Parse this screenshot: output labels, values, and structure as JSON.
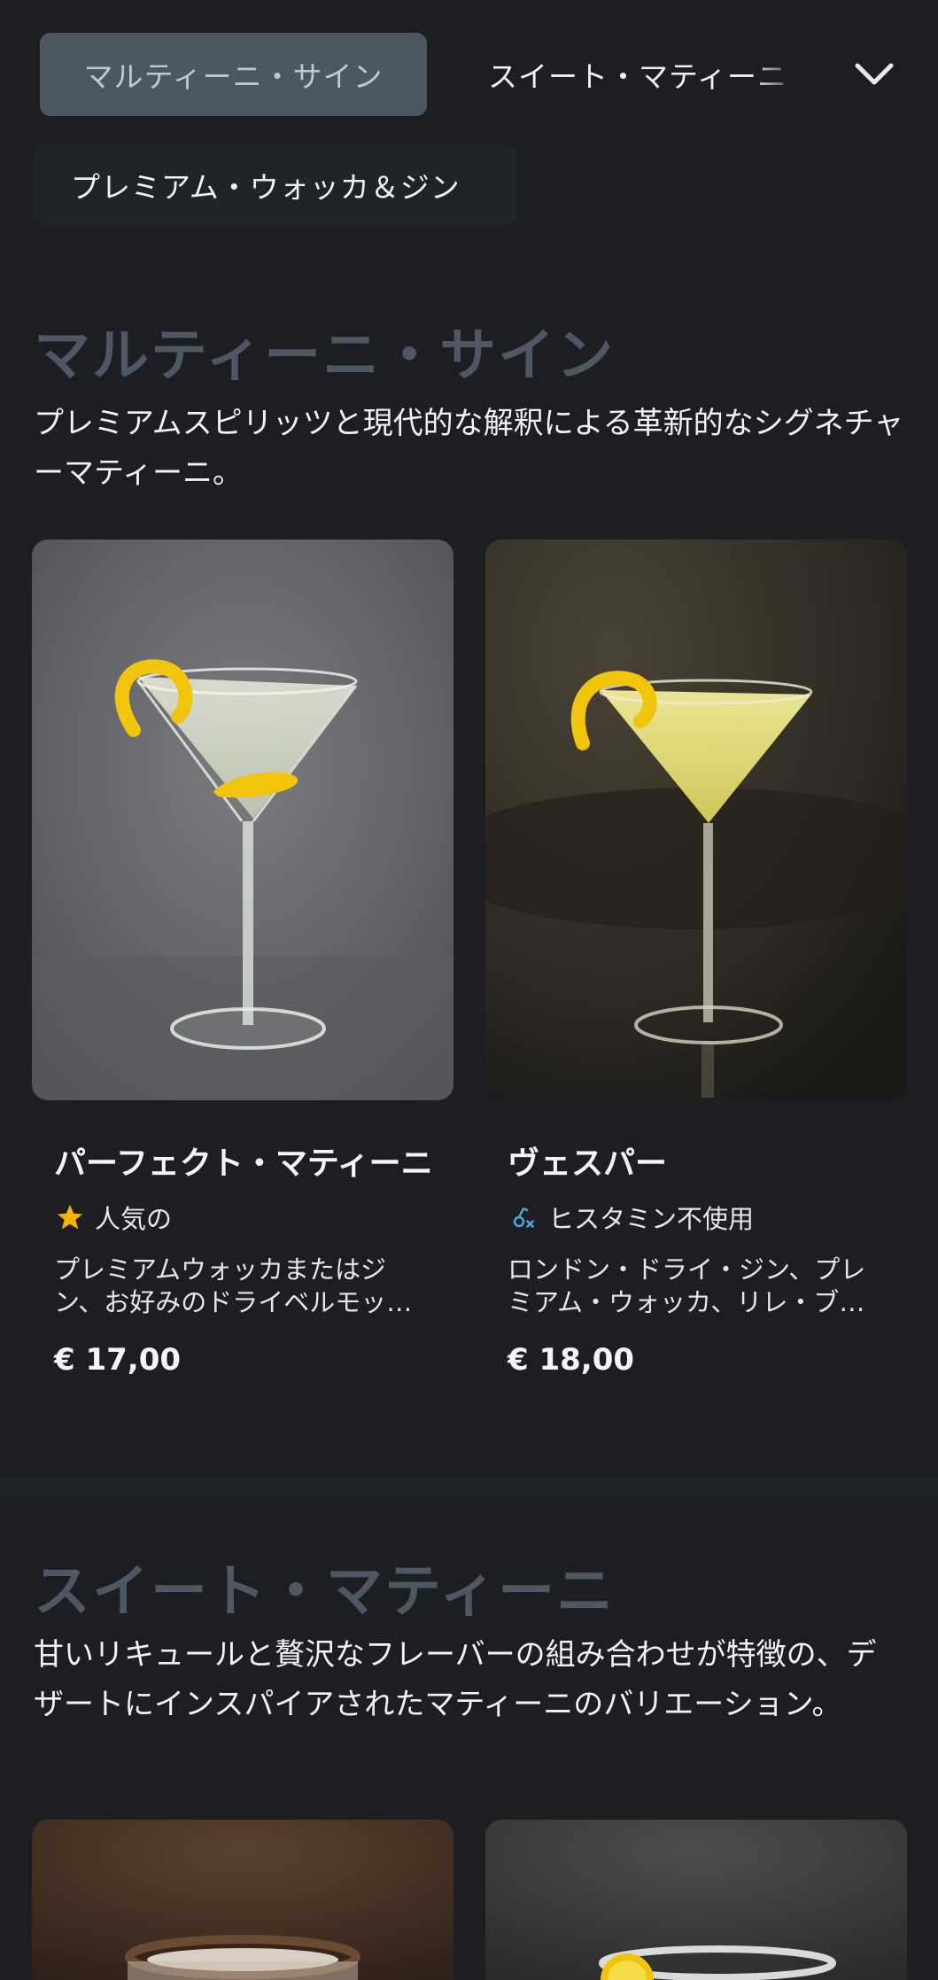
{
  "tabs": {
    "active": "マルティーニ・サイン",
    "second": "スイート・マティーニ",
    "third": "プレミアム・ウォッカ＆ジン"
  },
  "sections": [
    {
      "title": "マルティーニ・サイン",
      "description": "プレミアムスピリッツと現代的な解釈による革新的なシグネチャーマティーニ。",
      "cards": [
        {
          "name": "パーフェクト・マティーニ",
          "tag_icon": "star-icon",
          "tag": "人気の",
          "description": "プレミアムウォッカまたはジン、お好みのドライベルモット、オリーブまたはレモンピール添え",
          "price": "€ 17,00"
        },
        {
          "name": "ヴェスパー",
          "tag_icon": "histamine-free-icon",
          "tag": "ヒスタミン不使用",
          "description": "ロンドン・ドライ・ジン、プレミアム・ウォッカ、リレ・ブラン、レモンピール",
          "price": "€ 18,00"
        }
      ]
    },
    {
      "title": "スイート・マティーニ",
      "description": "甘いリキュールと贅沢なフレーバーの組み合わせが特徴の、デザートにインスパイアされたマティーニのバリエーション。"
    }
  ],
  "colors": {
    "background": "#1c1e22",
    "active_tab": "#4d5762",
    "section_title": "#4e5864",
    "star": "#f5b300",
    "histamine": "#4ea8d8"
  }
}
